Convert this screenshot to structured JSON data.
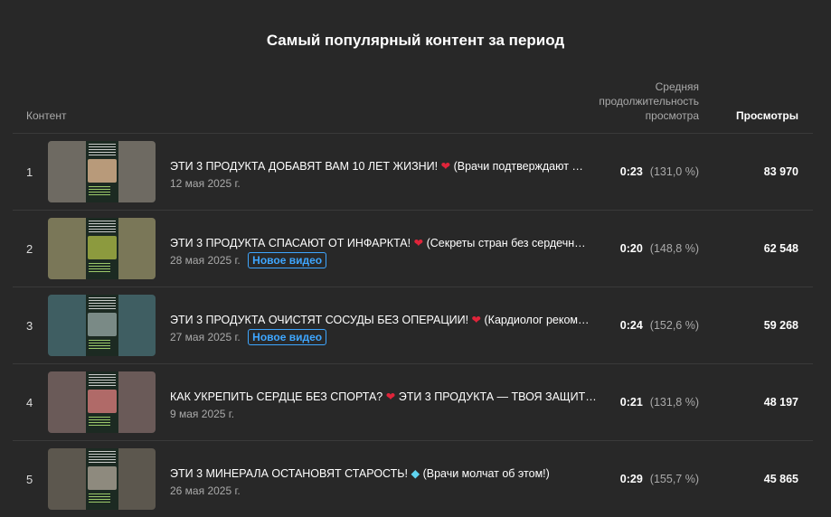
{
  "title": "Самый популярный контент за период",
  "headers": {
    "content": "Контент",
    "avg_duration": "Средняя продолжительность просмотра",
    "views": "Просмотры"
  },
  "rows": [
    {
      "rank": "1",
      "title_main": "ЭТИ 3 ПРОДУКТА ДОБАВЯТ ВАМ 10 ЛЕТ ЖИЗНИ!",
      "emoji": "heart",
      "title_rest": "(Врачи подтверждают …",
      "date": "12 мая 2025 г.",
      "badge": "",
      "duration": "0:23",
      "percent": "(131,0 %)",
      "views": "83 970",
      "thumb_bg": "#6e6a62",
      "thumb_img": "#b89a7a"
    },
    {
      "rank": "2",
      "title_main": "ЭТИ 3 ПРОДУКТА СПАСАЮТ ОТ ИНФАРКТА!",
      "emoji": "heart",
      "title_rest": "(Секреты стран без сердечн…",
      "date": "28 мая 2025 г.",
      "badge": "Новое видео",
      "duration": "0:20",
      "percent": "(148,8 %)",
      "views": "62 548",
      "thumb_bg": "#7a7758",
      "thumb_img": "#8c9a3e"
    },
    {
      "rank": "3",
      "title_main": "ЭТИ 3 ПРОДУКТА ОЧИСТЯТ СОСУДЫ БЕЗ ОПЕРАЦИИ!",
      "emoji": "heart",
      "title_rest": "(Кардиолог реком…",
      "date": "27 мая 2025 г.",
      "badge": "Новое видео",
      "duration": "0:24",
      "percent": "(152,6 %)",
      "views": "59 268",
      "thumb_bg": "#3f5e62",
      "thumb_img": "#7a8a86"
    },
    {
      "rank": "4",
      "title_main": "КАК УКРЕПИТЬ СЕРДЦЕ БЕЗ СПОРТА?",
      "emoji": "heart",
      "title_rest": "ЭТИ 3 ПРОДУКТА — ТВОЯ ЗАЩИТ…",
      "date": "9 мая 2025 г.",
      "badge": "",
      "duration": "0:21",
      "percent": "(131,8 %)",
      "views": "48 197",
      "thumb_bg": "#6a5a58",
      "thumb_img": "#b06a68"
    },
    {
      "rank": "5",
      "title_main": "ЭТИ 3 МИНЕРАЛА ОСТАНОВЯТ СТАРОСТЬ!",
      "emoji": "gem",
      "title_rest": "(Врачи молчат об этом!)",
      "date": "26 мая 2025 г.",
      "badge": "",
      "duration": "0:29",
      "percent": "(155,7 %)",
      "views": "45 865",
      "thumb_bg": "#5c574e",
      "thumb_img": "#8e8a7e"
    }
  ]
}
